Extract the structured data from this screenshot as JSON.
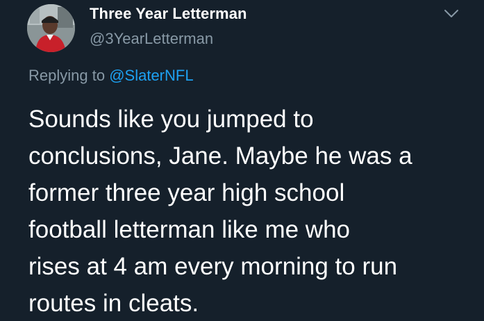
{
  "tweet": {
    "author": {
      "display_name": "Three Year Letterman",
      "handle": "@3YearLetterman"
    },
    "reply_prefix": "Replying to",
    "reply_to": "@SlaterNFL",
    "text_lines": [
      "Sounds like you jumped to",
      "conclusions, Jane. Maybe he was a",
      "former three year high school",
      "football letterman like me who",
      "rises at 4 am every morning to run",
      "routes in cleats."
    ]
  },
  "icons": {
    "menu": "chevron-down-icon",
    "avatar": "profile-photo"
  },
  "colors": {
    "background": "#15202b",
    "primary_text": "#ffffff",
    "secondary_text": "#8899a6",
    "link": "#1da1f2"
  }
}
